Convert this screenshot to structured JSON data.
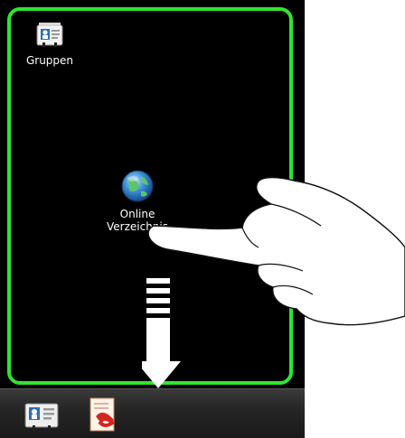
{
  "desktop": {
    "groups_label": "Gruppen",
    "online_label_line1": "Online",
    "online_label_line2": "Verzeichnis"
  },
  "icons": {
    "groups": "contacts-card-icon",
    "online": "globe-icon",
    "dock_contacts": "contacts-card-icon",
    "dock_phone": "phone-document-icon",
    "gesture": "hand-pointer-icon",
    "arrow": "arrow-down-icon"
  },
  "colors": {
    "frame_border": "#2ee52e",
    "background": "#000000",
    "dock": "#2a2a2a"
  }
}
